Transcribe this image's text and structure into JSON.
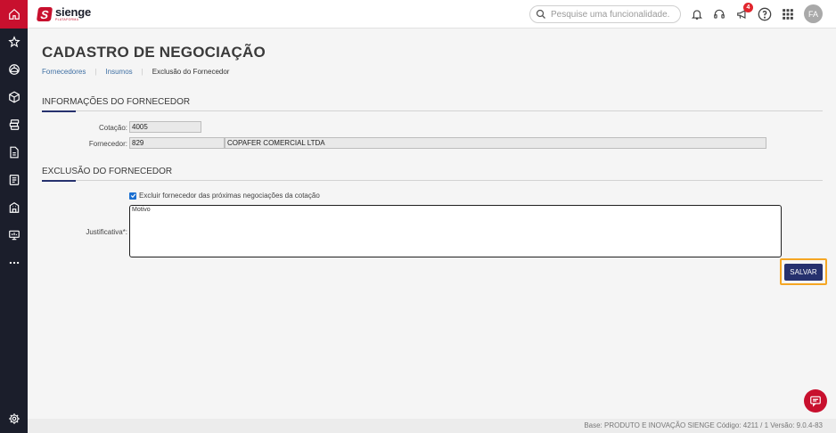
{
  "brand": {
    "name": "sienge",
    "sub": "PLATAFORMA"
  },
  "sidebar": {
    "items": [
      {
        "icon": "home-icon"
      },
      {
        "icon": "star-icon"
      },
      {
        "icon": "helmet-icon"
      },
      {
        "icon": "box-icon"
      },
      {
        "icon": "coins-icon"
      },
      {
        "icon": "document-icon"
      },
      {
        "icon": "list-document-icon"
      },
      {
        "icon": "building-icon"
      },
      {
        "icon": "monitor-icon"
      },
      {
        "icon": "more-icon"
      },
      {
        "icon": "settings-icon"
      }
    ]
  },
  "search": {
    "placeholder": "Pesquise uma funcionalidade."
  },
  "topbar": {
    "notifications_badge": "4",
    "avatar_initials": "FA"
  },
  "page": {
    "title": "CADASTRO DE NEGOCIAÇÃO",
    "breadcrumb": [
      "Fornecedores",
      "Insumos",
      "Exclusão do Fornecedor"
    ]
  },
  "supplier_info": {
    "title": "INFORMAÇÕES DO FORNECEDOR",
    "cotacao_label": "Cotação:",
    "cotacao_value": "4005",
    "fornecedor_label": "Fornecedor:",
    "fornecedor_code": "829",
    "fornecedor_name": "COPAFER COMERCIAL LTDA"
  },
  "exclusion": {
    "title": "EXCLUSÃO DO FORNECEDOR",
    "checkbox_label": "Excluir fornecedor das próximas negociações da cotação",
    "checkbox_checked": true,
    "justificativa_label": "Justificativa*:",
    "justificativa_placeholder": "Motivo",
    "save_label": "SALVAR"
  },
  "footer": {
    "text": "Base: PRODUTO E INOVAÇÃO SIENGE  Código: 4211 / 1  Versão: 9.0.4-83"
  },
  "colors": {
    "brand_red": "#c8102e",
    "sidebar_dark": "#1b1e2b",
    "primary_navy": "#26316e",
    "focus_orange": "#f5a623",
    "link_blue": "#3e6fa3"
  }
}
